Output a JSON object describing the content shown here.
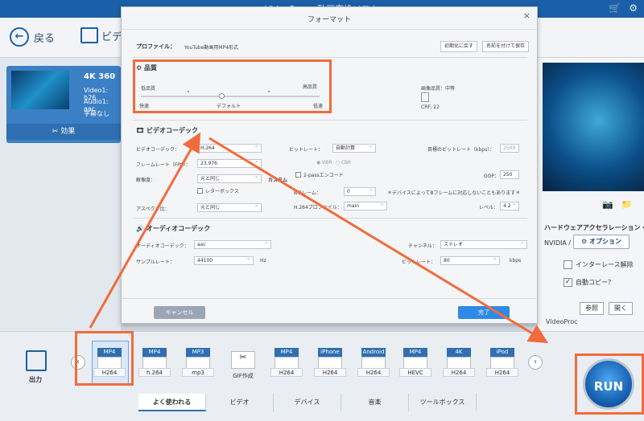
{
  "app": {
    "title": "VideoProc - 動画変換ソフト"
  },
  "toolbar": {
    "back_label": "戻る",
    "video_label": "ビデオ"
  },
  "video_card": {
    "title": "4K 360",
    "line1": "Video1: h26",
    "line2": "Audio1: aac",
    "line3": "字幕なし",
    "effect_label": "効果"
  },
  "dialog": {
    "title": "フォーマット",
    "profile_label": "プロファイル：",
    "profile_value": "YouTube動画用MP4形式",
    "reset_button": "初期化に戻す",
    "save_as_button": "名前を付けて保存",
    "quality": {
      "heading": "品質",
      "low_quality": "低品質",
      "high_quality": "高品質",
      "fast": "快速",
      "default": "デフォルト",
      "slow": "低速",
      "slider_value": 0.45,
      "image_quality_label": "画像品質：中等",
      "crf_label": "CRF: 22"
    },
    "video_codec": {
      "heading": "ビデオコーデック",
      "codec_label": "ビデオコーデック：",
      "codec_value": "H.264",
      "framerate_label": "フレームレート（FPS）：",
      "framerate_value": "23.976",
      "resolution_label": "解像度：",
      "resolution_value": "元と同じ",
      "letterbox_label": "レターボックス",
      "custom_label": "カスタム",
      "aspect_label": "アスペクト比：",
      "aspect_value": "元と同じ",
      "bitrate_label": "ビットレート：",
      "bitrate_value": "自動計算",
      "target_bitrate_label": "目標のビットレート（kbps）：",
      "target_bitrate_value": "2500",
      "vbr": "VBR",
      "cbr": "CBR",
      "two_pass_label": "2-passエンコード",
      "gop_label": "GOP：",
      "gop_value": "250",
      "bframe_label": "Bフレーム：",
      "bframe_value": "0",
      "bframe_note": "＊デバイスによってBフレームに対応しないこともあります＊",
      "profile264_label": "H.264プロファイル：",
      "profile264_value": "main",
      "level_label": "レベル：",
      "level_value": "4.2"
    },
    "audio_codec": {
      "heading": "オーディオコーデック",
      "codec_label": "オーディオコーデック：",
      "codec_value": "aac",
      "channel_label": "チャンネル：",
      "channel_value": "ステレオ",
      "samplerate_label": "サンプルレート：",
      "samplerate_value": "44100",
      "hz": "Hz",
      "bitrate_label": "ビットレート：",
      "bitrate_value": "80",
      "kbps": "kbps"
    },
    "cancel_button": "キャンセル",
    "done_button": "完了"
  },
  "right_panel": {
    "hw_accel": "ハードウェアアクセラレーション・エンジン：",
    "gpu": "NVIDIA / AMD",
    "option_button": "オプション",
    "deinterlace": "インターレース解除",
    "autocopy": "自動コピー？",
    "browse_button": "参照",
    "open_button": "開く",
    "output_folder": "VideoProc"
  },
  "bottom": {
    "output_label": "出力",
    "codecs": [
      {
        "tag": "MP4",
        "label": "H264"
      },
      {
        "tag": "MP4",
        "label": "h.264"
      },
      {
        "tag": "MP3",
        "label": "mp3"
      },
      {
        "tag": "",
        "label": "GIF作成"
      },
      {
        "tag": "MP4",
        "label": "H264"
      },
      {
        "tag": "iPhone",
        "label": "H264"
      },
      {
        "tag": "Android",
        "label": "H264"
      },
      {
        "tag": "MP4",
        "label": "HEVC"
      },
      {
        "tag": "4K",
        "label": "H264"
      },
      {
        "tag": "iPod",
        "label": "H264"
      }
    ],
    "tabs": [
      "よく使われる",
      "ビデオ",
      "デバイス",
      "音楽",
      "ツールボックス"
    ],
    "run_label": "RUN"
  }
}
